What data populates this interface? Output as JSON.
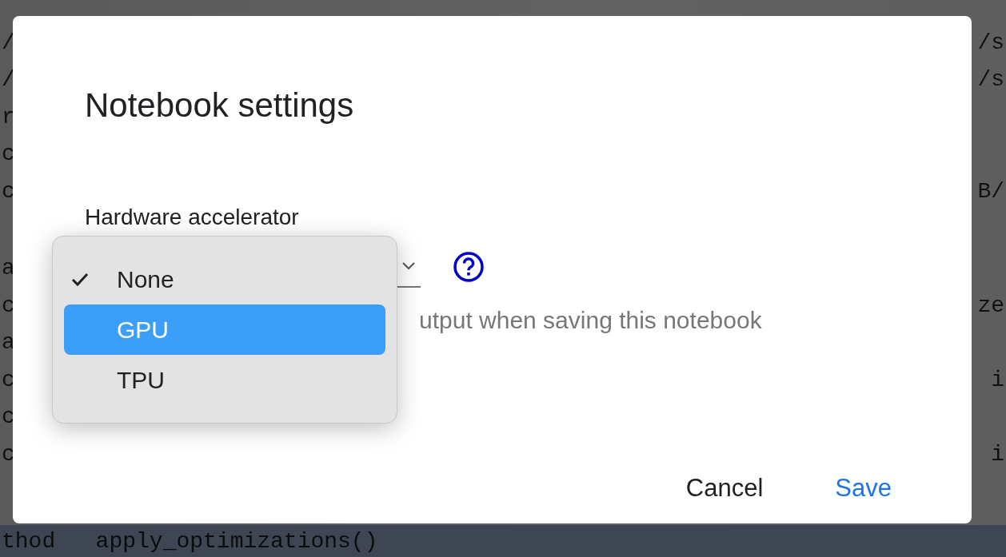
{
  "background_code": {
    "lines": [
      {
        "left": "/",
        "right": "/s"
      },
      {
        "left": "/",
        "right": "/s"
      },
      {
        "left": "r"
      },
      {
        "left": "c"
      },
      {
        "left": "c",
        "right": "B/"
      },
      {
        "left": "a"
      },
      {
        "left": "c",
        "right": "ze"
      },
      {
        "left": "a"
      },
      {
        "left": "c",
        "right": "i"
      },
      {
        "left": "c"
      },
      {
        "left": "c",
        "right": "i"
      },
      {
        "left": "thod   apply_optimizations()"
      }
    ]
  },
  "dialog": {
    "title": "Notebook settings",
    "hardware_accelerator": {
      "label": "Hardware accelerator",
      "options": [
        {
          "label": "None",
          "checked": true,
          "highlighted": false
        },
        {
          "label": "GPU",
          "checked": false,
          "highlighted": true
        },
        {
          "label": "TPU",
          "checked": false,
          "highlighted": false
        }
      ]
    },
    "omit_output_option": {
      "label": "utput when saving this notebook"
    },
    "buttons": [
      {
        "label": "Cancel",
        "kind": "text"
      },
      {
        "label": "Save",
        "kind": "primary"
      }
    ]
  }
}
